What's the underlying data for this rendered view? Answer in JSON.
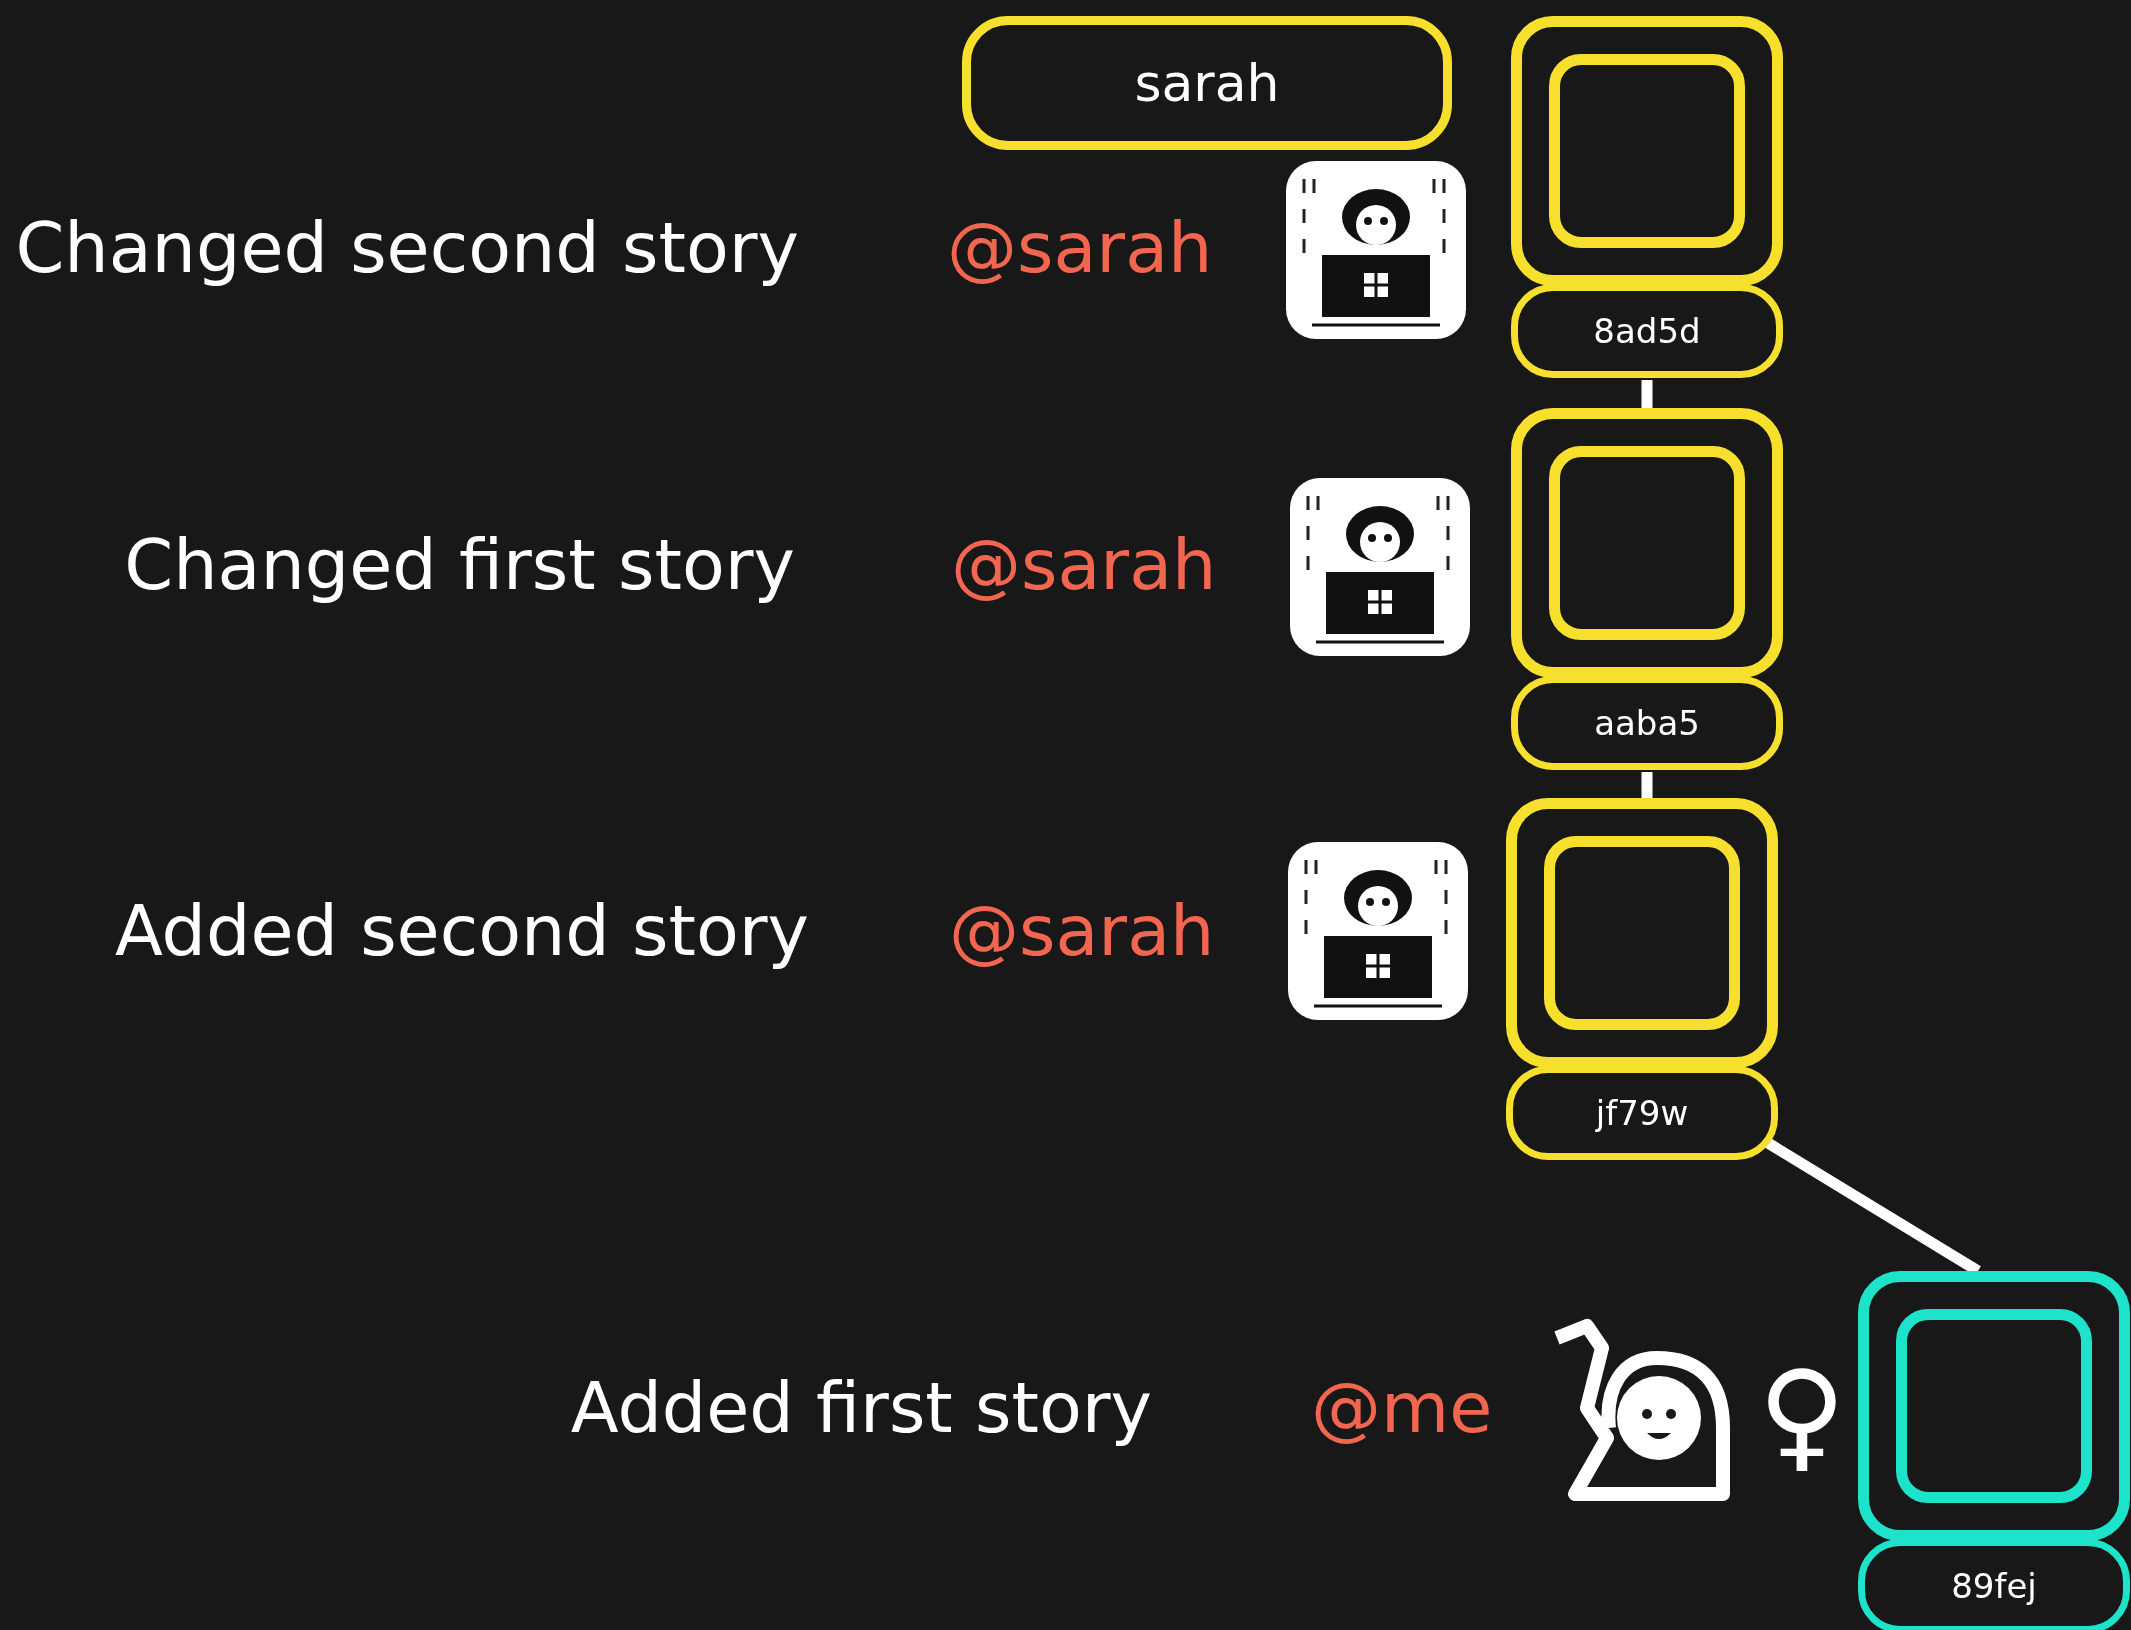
{
  "branch": {
    "label": "sarah",
    "color": "#f7df2e"
  },
  "commits": [
    {
      "message": "Changed second story",
      "author": "@sarah",
      "kind": "laptop",
      "hash": "8ad5d",
      "color": "#f7df2e"
    },
    {
      "message": "Changed first story",
      "author": "@sarah",
      "kind": "laptop",
      "hash": "aaba5",
      "color": "#f7df2e"
    },
    {
      "message": "Added second story",
      "author": "@sarah",
      "kind": "laptop",
      "hash": "jf79w",
      "color": "#f7df2e"
    },
    {
      "message": "Added first story",
      "author": "@me",
      "kind": "raising-hand",
      "symbol": "♀",
      "hash": "89fej",
      "color": "#1de3cb"
    }
  ]
}
